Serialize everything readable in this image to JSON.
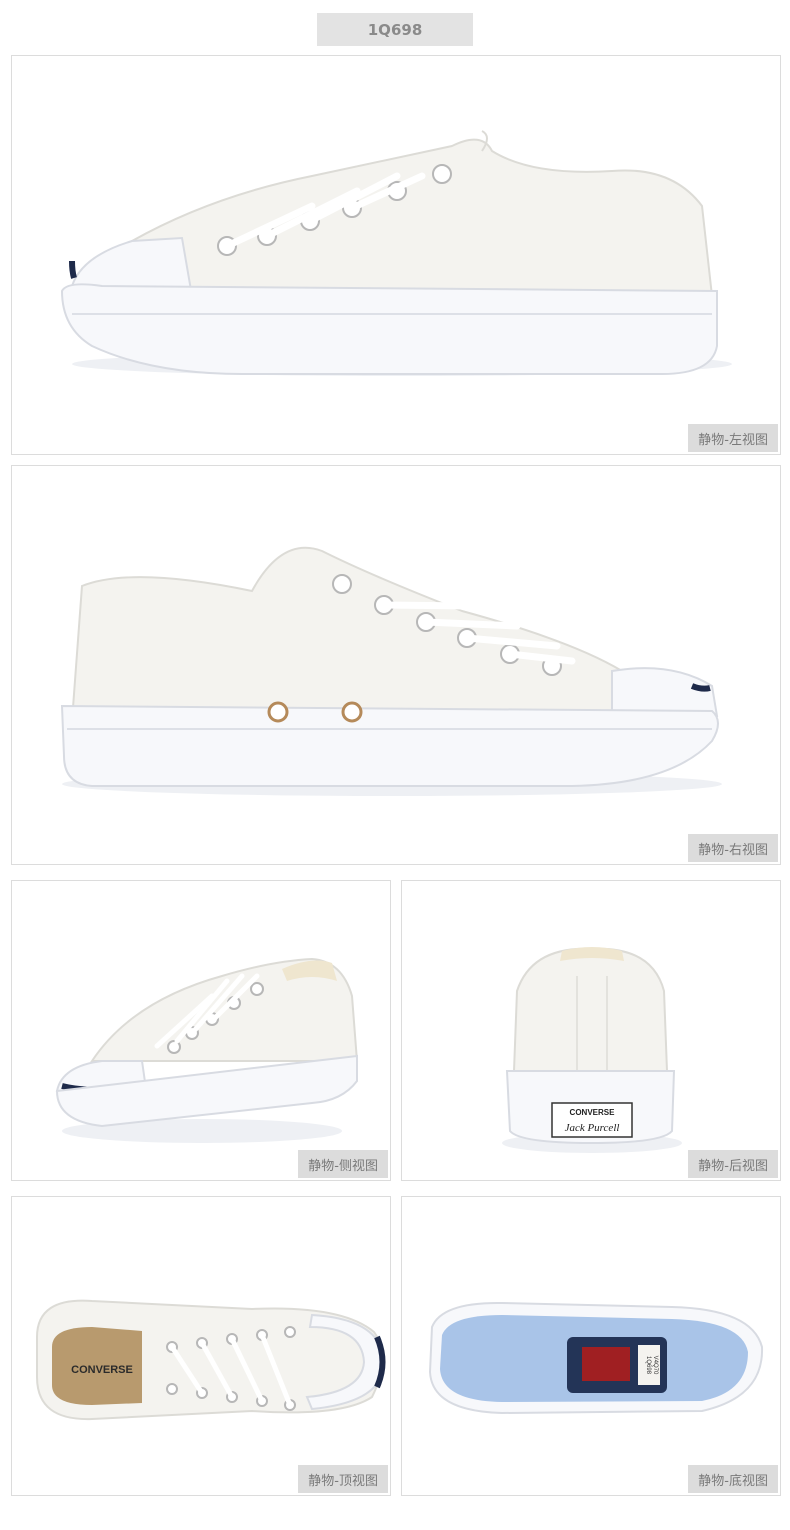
{
  "product_code": "1Q698",
  "views": {
    "left": "静物-左视图",
    "right": "静物-右视图",
    "side": "静物-侧视图",
    "back": "静物-后视图",
    "top": "静物-顶视图",
    "bottom": "静物-底视图"
  },
  "heel_label": {
    "brand": "CONVERSE",
    "model": "Jack Purcell"
  },
  "insole_brand": "CONVERSE",
  "sole_label": {
    "line1": "1Q698",
    "line2": "V4Q70"
  },
  "colors": {
    "canvas": "#f4f3ef",
    "rubber": "#f7f8fb",
    "smile_navy": "#1e2a4a",
    "outsole_blue": "#a9c4e8",
    "sole_badge_red": "#a01f22",
    "label_bg": "#dcdcdc",
    "label_text": "#7a7a7a"
  }
}
